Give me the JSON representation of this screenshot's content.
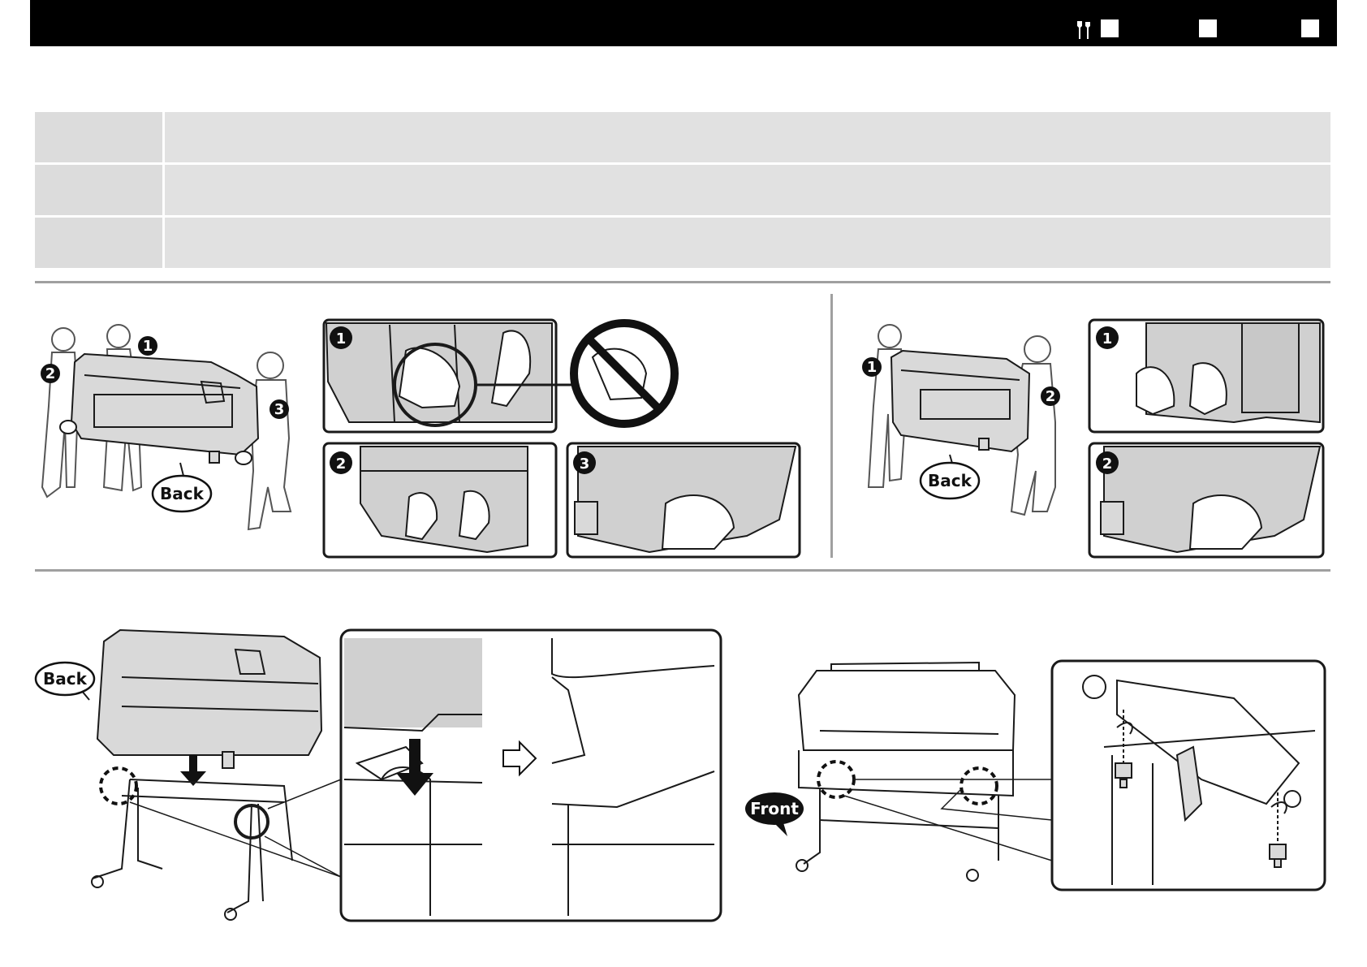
{
  "callouts": {
    "back": "Back",
    "front": "Front"
  },
  "step_numbers": {
    "one": "1",
    "two": "2",
    "three": "3"
  },
  "colors": {
    "header_bar": "#000000",
    "table_fill": "#e1e1e1",
    "divider": "#a0a0a0",
    "machine_fill": "#d9d9d9"
  },
  "icons": {
    "header_tool": "screwdriver-wrench-icon",
    "prohibited": "no-symbol-icon",
    "arrow_down": "arrow-down-icon",
    "arrow_right": "arrow-right-icon"
  }
}
